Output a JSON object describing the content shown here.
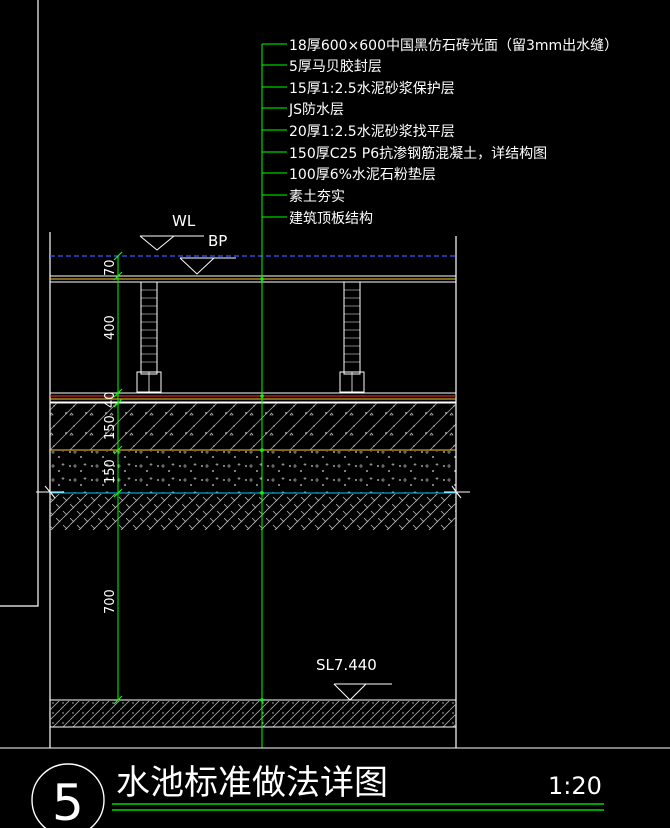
{
  "layer_notes": [
    "18厚600×600中国黑仿石砖光面（留3mm出水缝）",
    "5厚马贝胶封层",
    "15厚1:2.5水泥砂浆保护层",
    "JS防水层",
    "20厚1:2.5水泥砂浆找平层",
    "150厚C25 P6抗渗钢筋混凝土，详结构图",
    "100厚6%水泥石粉垫层",
    "素土夯实",
    "建筑顶板结构"
  ],
  "levels": {
    "water_level": "WL",
    "bp": "BP",
    "sl": "SL7.440"
  },
  "dimensions": [
    "70",
    "400",
    "40",
    "150",
    "150",
    "700"
  ],
  "title": {
    "number": "5",
    "name": "水池标准做法详图",
    "scale": "1:20"
  },
  "colors": {
    "background": "#000000",
    "leader": "#00ff00",
    "text": "#ffffff",
    "water_line": "#3b5bff",
    "mortar_line": "#ffcc33",
    "gravel_line": "#00ccff",
    "hatch": "#bfbfbf"
  }
}
